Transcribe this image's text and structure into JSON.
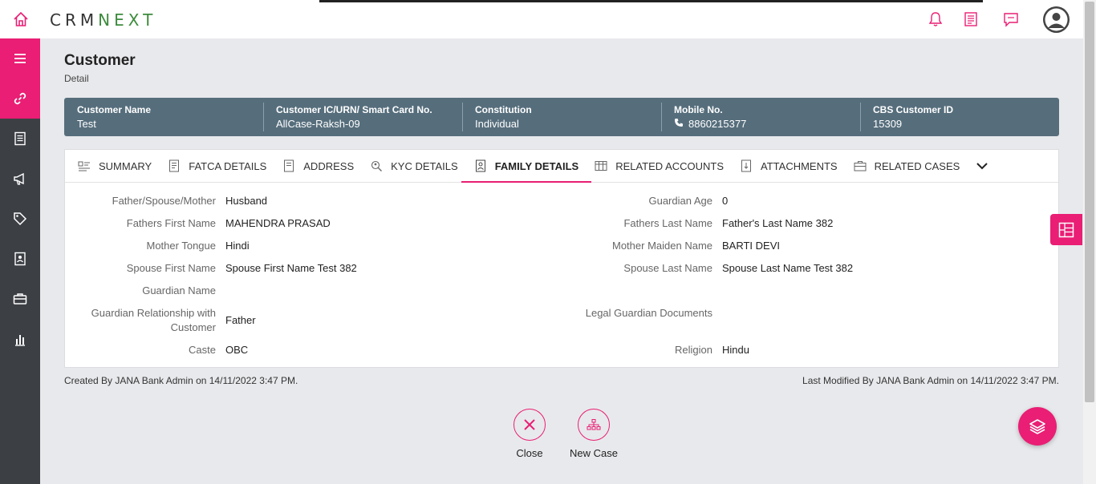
{
  "app": {
    "logo_crm": "CRM",
    "logo_next": "NEXT",
    "icons": [
      "home-icon",
      "bell-icon",
      "notes-icon",
      "chat-icon",
      "user-avatar"
    ],
    "accent": "#e91e74",
    "infobar_color": "#566e7c"
  },
  "sidebar": {
    "items": [
      {
        "name": "menu-icon"
      },
      {
        "name": "link-icon"
      },
      {
        "name": "list-icon"
      },
      {
        "name": "megaphone-icon"
      },
      {
        "name": "tag-icon"
      },
      {
        "name": "contact-book-icon"
      },
      {
        "name": "briefcase-icon"
      },
      {
        "name": "bar-chart-icon"
      }
    ]
  },
  "page": {
    "title": "Customer",
    "subtitle": "Detail"
  },
  "info_bar": {
    "cells": [
      {
        "label": "Customer Name",
        "value": "Test"
      },
      {
        "label": "Customer IC/URN/ Smart Card No.",
        "value": "AllCase-Raksh-09"
      },
      {
        "label": "Constitution",
        "value": "Individual"
      },
      {
        "label": "Mobile No.",
        "value": "8860215377"
      },
      {
        "label": "CBS Customer ID",
        "value": "15309"
      }
    ]
  },
  "tabs": [
    {
      "label": "SUMMARY",
      "icon": "summary-icon"
    },
    {
      "label": "FATCA DETAILS",
      "icon": "document-icon"
    },
    {
      "label": "ADDRESS",
      "icon": "address-icon"
    },
    {
      "label": "KYC DETAILS",
      "icon": "kyc-icon"
    },
    {
      "label": "FAMILY DETAILS",
      "icon": "family-icon",
      "active": true
    },
    {
      "label": "RELATED ACCOUNTS",
      "icon": "accounts-icon"
    },
    {
      "label": "ATTACHMENTS",
      "icon": "attachment-icon"
    },
    {
      "label": "RELATED CASES",
      "icon": "cases-icon"
    }
  ],
  "fields": {
    "father_spouse_mother": {
      "label": "Father/Spouse/Mother",
      "value": "Husband"
    },
    "fathers_first_name": {
      "label": "Fathers First Name",
      "value": "MAHENDRA PRASAD"
    },
    "mother_tongue": {
      "label": "Mother Tongue",
      "value": "Hindi"
    },
    "spouse_first_name": {
      "label": "Spouse First Name",
      "value": "Spouse First Name Test 382"
    },
    "guardian_name": {
      "label": "Guardian Name",
      "value": ""
    },
    "guardian_relationship": {
      "label_line1": "Guardian Relationship with",
      "label_line2": "Customer",
      "value": "Father"
    },
    "caste": {
      "label": "Caste",
      "value": "OBC"
    },
    "guardian_age": {
      "label": "Guardian Age",
      "value": "0"
    },
    "fathers_last_name": {
      "label": "Fathers Last Name",
      "value": "Father's Last Name 382"
    },
    "mother_maiden_name": {
      "label": "Mother Maiden Name",
      "value": "BARTI DEVI"
    },
    "spouse_last_name": {
      "label": "Spouse Last Name",
      "value": "Spouse Last Name Test 382"
    },
    "legal_guardian_documents": {
      "label": "Legal Guardian Documents",
      "value": ""
    },
    "religion": {
      "label": "Religion",
      "value": "Hindu"
    }
  },
  "footer": {
    "created": "Created By JANA Bank Admin on 14/11/2022 3:47 PM.",
    "modified": "Last Modified By JANA Bank Admin on 14/11/2022 3:47 PM."
  },
  "actions": {
    "close_label": "Close",
    "new_case_label": "New Case"
  }
}
